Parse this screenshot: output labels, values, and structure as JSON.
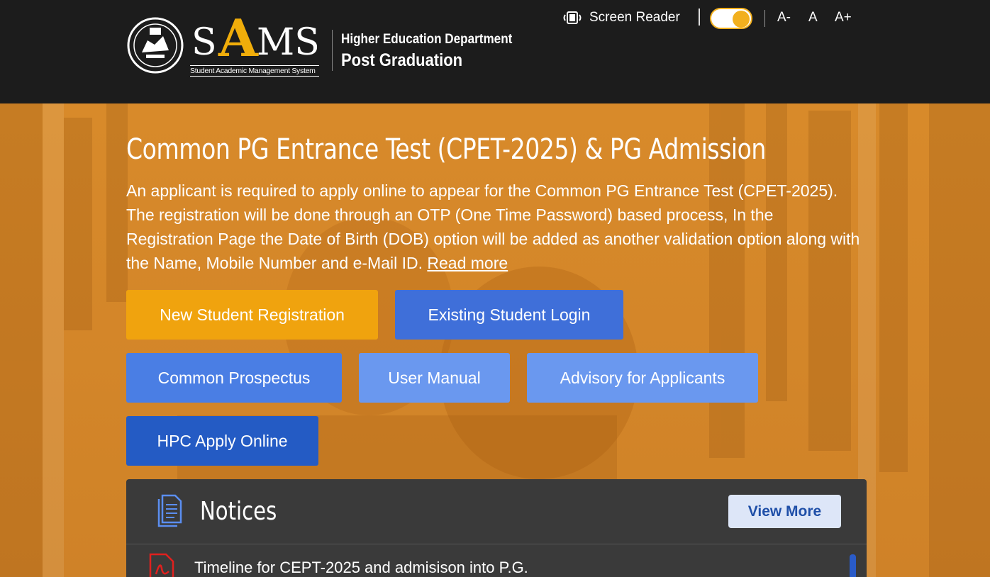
{
  "header": {
    "logo_word_s": "S",
    "logo_word_a": "A",
    "logo_word_ms": "MS",
    "logo_subtitle": "Student Academic Management System",
    "department": "Higher Education Department",
    "program": "Post Graduation",
    "screen_reader_label": "Screen Reader",
    "font_decrease": "A-",
    "font_normal": "A",
    "font_increase": "A+",
    "toggle_color": "#f2b01e"
  },
  "hero": {
    "title": "Common PG Entrance Test (CPET-2025) & PG Admission",
    "description": "An applicant is required to apply online to appear for the Common PG Entrance Test (CPET-2025). The registration will be done through an OTP (One Time Password) based process, In the Registration Page the Date of Birth (DOB) option will be added as another validation option along with the Name, Mobile Number and e-Mail ID.",
    "read_more": "Read more",
    "background_color": "#d88a2a"
  },
  "buttons": {
    "new_registration": "New Student Registration",
    "existing_login": "Existing Student Login",
    "common_prospectus": "Common Prospectus",
    "user_manual": "User Manual",
    "advisory": "Advisory for Applicants",
    "hpc_apply": "HPC Apply Online"
  },
  "notices": {
    "title": "Notices",
    "view_more": "View More",
    "items": [
      {
        "text": "Timeline for CEPT-2025 and admisison into P.G.",
        "icon": "pdf-icon"
      }
    ]
  }
}
